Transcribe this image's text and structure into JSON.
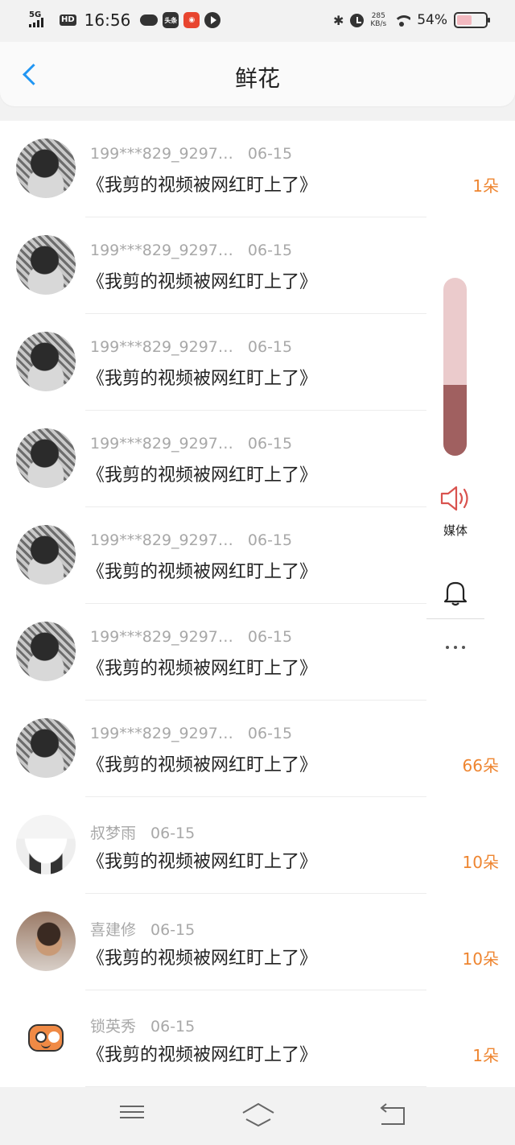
{
  "status_bar": {
    "network": "5G",
    "hd": "HD",
    "time": "16:56",
    "app_icons": [
      "cloud-icon",
      "toutiao-icon",
      "red-app-icon",
      "play-icon"
    ],
    "toutiao_label": "头条",
    "net_speed_value": "285",
    "net_speed_unit": "KB/s",
    "battery_percent": "54%",
    "battery_level": 0.54
  },
  "header": {
    "title": "鲜花",
    "back_icon": "chevron-left-icon",
    "accent_color": "#2196f3"
  },
  "list": {
    "items": [
      {
        "name": "199***829_9297…",
        "date": "06-15",
        "work": "《我剪的视频被网红盯上了》",
        "flowers": "1朵",
        "avatar": "bw"
      },
      {
        "name": "199***829_9297…",
        "date": "06-15",
        "work": "《我剪的视频被网红盯上了》",
        "flowers": "",
        "avatar": "bw"
      },
      {
        "name": "199***829_9297…",
        "date": "06-15",
        "work": "《我剪的视频被网红盯上了》",
        "flowers": "",
        "avatar": "bw"
      },
      {
        "name": "199***829_9297…",
        "date": "06-15",
        "work": "《我剪的视频被网红盯上了》",
        "flowers": "",
        "avatar": "bw"
      },
      {
        "name": "199***829_9297…",
        "date": "06-15",
        "work": "《我剪的视频被网红盯上了》",
        "flowers": "",
        "avatar": "bw"
      },
      {
        "name": "199***829_9297…",
        "date": "06-15",
        "work": "《我剪的视频被网红盯上了》",
        "flowers": "",
        "avatar": "bw"
      },
      {
        "name": "199***829_9297…",
        "date": "06-15",
        "work": "《我剪的视频被网红盯上了》",
        "flowers": "66朵",
        "avatar": "bw"
      },
      {
        "name": "叔梦雨",
        "date": "06-15",
        "work": "《我剪的视频被网红盯上了》",
        "flowers": "10朵",
        "avatar": "stock"
      },
      {
        "name": "喜建修",
        "date": "06-15",
        "work": "《我剪的视频被网红盯上了》",
        "flowers": "10朵",
        "avatar": "man"
      },
      {
        "name": "锁英秀",
        "date": "06-15",
        "work": "《我剪的视频被网红盯上了》",
        "flowers": "1朵",
        "avatar": "cartoon"
      }
    ],
    "flower_color": "#ee8530"
  },
  "volume": {
    "label": "媒体",
    "level": 0.4,
    "track_color": "#ebcbcc",
    "fill_color": "#a06060",
    "icons": [
      "speaker-icon",
      "bell-icon",
      "more-icon"
    ]
  },
  "nav_bar": {
    "icons": [
      "menu-icon",
      "home-icon",
      "back-icon"
    ]
  }
}
